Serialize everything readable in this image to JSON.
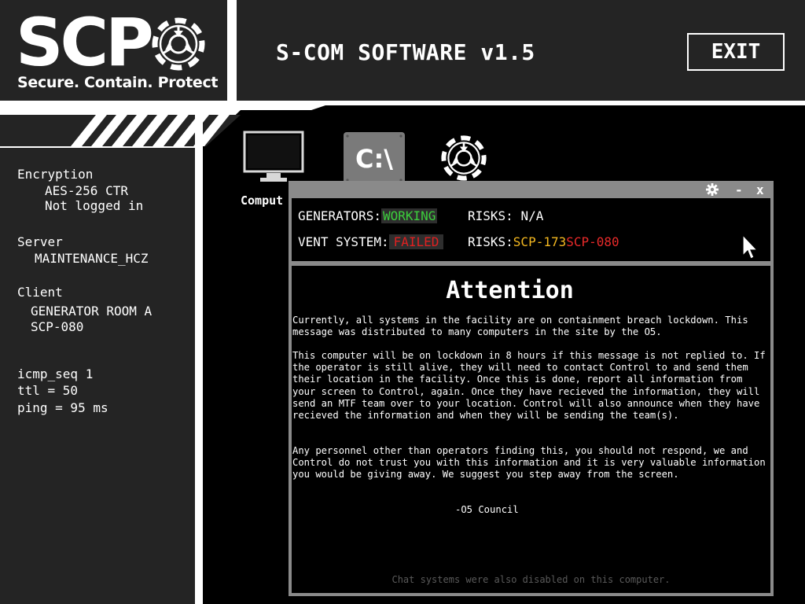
{
  "header": {
    "logo_text": "SCP",
    "logo_tagline": "Secure. Contain. Protect",
    "app_title": "S-COM SOFTWARE v1.5",
    "exit_label": "EXIT"
  },
  "sidebar": {
    "encryption_label": "Encryption",
    "encryption_value": "AES-256 CTR",
    "login_status": "Not logged in",
    "server_label": "Server",
    "server_value": "MAINTENANCE_HCZ",
    "client_label": "Client",
    "client_value_1": "GENERATOR ROOM A",
    "client_value_2": "SCP-080",
    "icmp_seq": "icmp_seq 1",
    "ttl": "ttl = 50",
    "ping": "ping = 95 ms"
  },
  "desktop": {
    "icons": [
      {
        "name": "computer-icon",
        "label": "Comput"
      },
      {
        "name": "command-prompt-icon",
        "glyph": "C:\\"
      },
      {
        "name": "scp-emblem-icon"
      }
    ]
  },
  "window": {
    "buttons": {
      "minimize": "-",
      "close": "x"
    },
    "status": {
      "generators_label": "GENERATORS:",
      "generators_value": "WORKING",
      "generators_risks_label": "RISKS:",
      "generators_risks_value": "N/A",
      "vent_label": "VENT SYSTEM:",
      "vent_value": "FAILED",
      "vent_risks_label": "RISKS:",
      "vent_risk_1": "SCP-173",
      "vent_risk_2": "SCP-080"
    },
    "message": {
      "title": "Attention",
      "paragraph_1": "Currently, all systems in the facility are on containment breach lockdown. This message was distributed to many computers in the site by the O5.",
      "paragraph_2": "This computer will be on lockdown in 8 hours if this message is not replied to. If the operator is still alive, they will need to contact Control to and send them their location in the facility. Once this is done, report all information from your screen to Control, again. Once they have recieved the information, they will send an MTF team over to your location. Control will also announce when they have recieved the information and when they will be sending the team(s).",
      "paragraph_3": "Any personnel other than operators finding this, you should not respond, we and Control do not trust you with this information and it is very valuable information you would be giving away. We suggest you step away from the screen.",
      "signoff": "-O5 Council"
    },
    "footnote": "Chat systems were also disabled on this computer."
  },
  "colors": {
    "panel": "#242424",
    "working": "#3ccf3c",
    "failed": "#e02020",
    "risk_yellow": "#f4b820",
    "risk_red": "#e82a2a",
    "window_frame": "#8a8a8a"
  }
}
